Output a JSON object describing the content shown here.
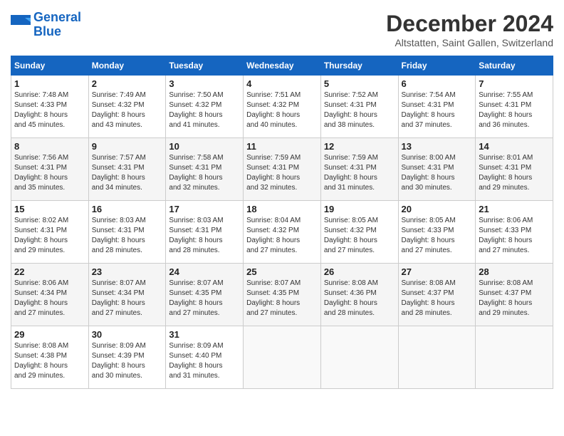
{
  "header": {
    "logo_line1": "General",
    "logo_line2": "Blue",
    "month": "December 2024",
    "location": "Altstatten, Saint Gallen, Switzerland"
  },
  "weekdays": [
    "Sunday",
    "Monday",
    "Tuesday",
    "Wednesday",
    "Thursday",
    "Friday",
    "Saturday"
  ],
  "weeks": [
    [
      {
        "day": "1",
        "sunrise": "7:48 AM",
        "sunset": "4:33 PM",
        "daylight": "8 hours and 45 minutes."
      },
      {
        "day": "2",
        "sunrise": "7:49 AM",
        "sunset": "4:32 PM",
        "daylight": "8 hours and 43 minutes."
      },
      {
        "day": "3",
        "sunrise": "7:50 AM",
        "sunset": "4:32 PM",
        "daylight": "8 hours and 41 minutes."
      },
      {
        "day": "4",
        "sunrise": "7:51 AM",
        "sunset": "4:32 PM",
        "daylight": "8 hours and 40 minutes."
      },
      {
        "day": "5",
        "sunrise": "7:52 AM",
        "sunset": "4:31 PM",
        "daylight": "8 hours and 38 minutes."
      },
      {
        "day": "6",
        "sunrise": "7:54 AM",
        "sunset": "4:31 PM",
        "daylight": "8 hours and 37 minutes."
      },
      {
        "day": "7",
        "sunrise": "7:55 AM",
        "sunset": "4:31 PM",
        "daylight": "8 hours and 36 minutes."
      }
    ],
    [
      {
        "day": "8",
        "sunrise": "7:56 AM",
        "sunset": "4:31 PM",
        "daylight": "8 hours and 35 minutes."
      },
      {
        "day": "9",
        "sunrise": "7:57 AM",
        "sunset": "4:31 PM",
        "daylight": "8 hours and 34 minutes."
      },
      {
        "day": "10",
        "sunrise": "7:58 AM",
        "sunset": "4:31 PM",
        "daylight": "8 hours and 32 minutes."
      },
      {
        "day": "11",
        "sunrise": "7:59 AM",
        "sunset": "4:31 PM",
        "daylight": "8 hours and 32 minutes."
      },
      {
        "day": "12",
        "sunrise": "7:59 AM",
        "sunset": "4:31 PM",
        "daylight": "8 hours and 31 minutes."
      },
      {
        "day": "13",
        "sunrise": "8:00 AM",
        "sunset": "4:31 PM",
        "daylight": "8 hours and 30 minutes."
      },
      {
        "day": "14",
        "sunrise": "8:01 AM",
        "sunset": "4:31 PM",
        "daylight": "8 hours and 29 minutes."
      }
    ],
    [
      {
        "day": "15",
        "sunrise": "8:02 AM",
        "sunset": "4:31 PM",
        "daylight": "8 hours and 29 minutes."
      },
      {
        "day": "16",
        "sunrise": "8:03 AM",
        "sunset": "4:31 PM",
        "daylight": "8 hours and 28 minutes."
      },
      {
        "day": "17",
        "sunrise": "8:03 AM",
        "sunset": "4:31 PM",
        "daylight": "8 hours and 28 minutes."
      },
      {
        "day": "18",
        "sunrise": "8:04 AM",
        "sunset": "4:32 PM",
        "daylight": "8 hours and 27 minutes."
      },
      {
        "day": "19",
        "sunrise": "8:05 AM",
        "sunset": "4:32 PM",
        "daylight": "8 hours and 27 minutes."
      },
      {
        "day": "20",
        "sunrise": "8:05 AM",
        "sunset": "4:33 PM",
        "daylight": "8 hours and 27 minutes."
      },
      {
        "day": "21",
        "sunrise": "8:06 AM",
        "sunset": "4:33 PM",
        "daylight": "8 hours and 27 minutes."
      }
    ],
    [
      {
        "day": "22",
        "sunrise": "8:06 AM",
        "sunset": "4:34 PM",
        "daylight": "8 hours and 27 minutes."
      },
      {
        "day": "23",
        "sunrise": "8:07 AM",
        "sunset": "4:34 PM",
        "daylight": "8 hours and 27 minutes."
      },
      {
        "day": "24",
        "sunrise": "8:07 AM",
        "sunset": "4:35 PM",
        "daylight": "8 hours and 27 minutes."
      },
      {
        "day": "25",
        "sunrise": "8:07 AM",
        "sunset": "4:35 PM",
        "daylight": "8 hours and 27 minutes."
      },
      {
        "day": "26",
        "sunrise": "8:08 AM",
        "sunset": "4:36 PM",
        "daylight": "8 hours and 28 minutes."
      },
      {
        "day": "27",
        "sunrise": "8:08 AM",
        "sunset": "4:37 PM",
        "daylight": "8 hours and 28 minutes."
      },
      {
        "day": "28",
        "sunrise": "8:08 AM",
        "sunset": "4:37 PM",
        "daylight": "8 hours and 29 minutes."
      }
    ],
    [
      {
        "day": "29",
        "sunrise": "8:08 AM",
        "sunset": "4:38 PM",
        "daylight": "8 hours and 29 minutes."
      },
      {
        "day": "30",
        "sunrise": "8:09 AM",
        "sunset": "4:39 PM",
        "daylight": "8 hours and 30 minutes."
      },
      {
        "day": "31",
        "sunrise": "8:09 AM",
        "sunset": "4:40 PM",
        "daylight": "8 hours and 31 minutes."
      },
      null,
      null,
      null,
      null
    ]
  ],
  "labels": {
    "sunrise": "Sunrise:",
    "sunset": "Sunset:",
    "daylight": "Daylight:"
  }
}
